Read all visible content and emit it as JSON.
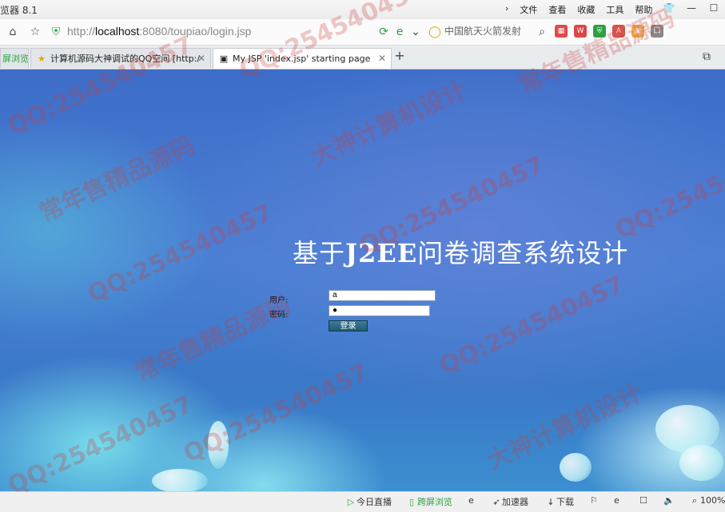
{
  "browser": {
    "app_name": "览器 8.1",
    "menu": [
      "文件",
      "查看",
      "收藏",
      "工具",
      "帮助"
    ],
    "window_buttons": [
      "shirt-icon",
      "minimize-icon",
      "maximize-icon"
    ],
    "url_host": "localhost",
    "url_prefix": "http://",
    "url_suffix": ":8080/toupiao/login.jsp",
    "search_text": "中国航天火箭发射",
    "tabs": [
      {
        "label": "屏浏览",
        "icon": "green-screen-icon"
      },
      {
        "label": "计算机源码大神调试的QQ空间 [http:/",
        "icon": "star-icon"
      },
      {
        "label": "My JSP 'index.jsp' starting page",
        "icon": "page-icon"
      }
    ],
    "new_tab": "+"
  },
  "page": {
    "title_cn1": "基于",
    "title_lat": "J2EE",
    "title_cn2": "问卷调查系统设计",
    "user_label": "用户:",
    "user_value": "a",
    "pass_label": "密码:",
    "pass_value": "●",
    "login_label": "登录"
  },
  "status": {
    "items": [
      {
        "label": "今日直播",
        "icon": "play-icon"
      },
      {
        "label": "跨屏浏览",
        "icon": "phone-icon"
      },
      {
        "label": "",
        "icon": "ie-icon"
      },
      {
        "label": "加速器",
        "icon": "rocket-icon"
      },
      {
        "label": "下载",
        "icon": "download-icon"
      },
      {
        "label": "",
        "icon": "flag-icon"
      },
      {
        "label": "",
        "icon": "browser-icon"
      },
      {
        "label": "",
        "icon": "window-icon"
      },
      {
        "label": "",
        "icon": "speaker-icon"
      },
      {
        "label": "100%",
        "icon": "zoom-icon"
      }
    ]
  },
  "watermarks": {
    "qq": "QQ:254540457",
    "shop": "常年售精品源码",
    "god": "大神计算机设计"
  }
}
